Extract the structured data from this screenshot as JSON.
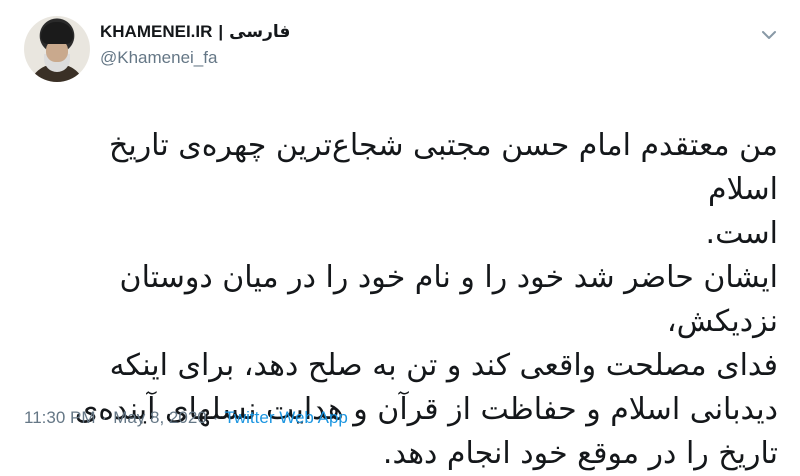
{
  "account": {
    "display_name": "KHAMENEI.IR",
    "separator": "|",
    "language_label": "فارسی",
    "handle": "@Khamenei_fa"
  },
  "icons": {
    "menu": "chevron-down-icon",
    "avatar": "avatar"
  },
  "tweet": {
    "text": "من معتقدم امام حسن مجتبی شجاع‌ترین چهره‌ی تاریخ اسلام\nاست.\nایشان حاضر شد خود را و نام خود را در میان دوستان نزدیکش،\nفدای مصلحت واقعی کند و تن به صلح دهد، برای اینکه\nدیدبانی اسلام و حفاظت از قرآن و هدایت نسلهای آینده‌ی\nتاریخ را در موقع خود انجام دهد."
  },
  "meta": {
    "time": "11:30 PM",
    "dot1": "·",
    "date": "May 8, 2020",
    "dot2": "·",
    "source": "Twitter Web App"
  },
  "colors": {
    "text": "#14171a",
    "secondary": "#657786",
    "link": "#1b95e0"
  }
}
